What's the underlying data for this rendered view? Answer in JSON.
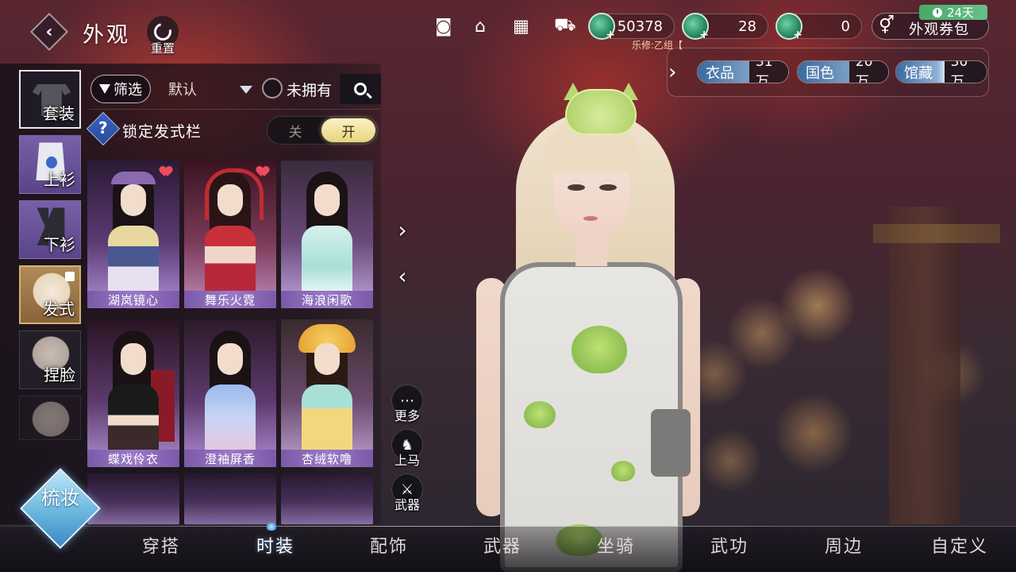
{
  "header": {
    "title": "外观",
    "reset_label": "重置"
  },
  "top_icons": [
    {
      "icon": "camera-icon",
      "caption": ""
    },
    {
      "icon": "shop-icon",
      "caption": ""
    },
    {
      "icon": "store-icon",
      "caption": ""
    },
    {
      "icon": "cart-icon",
      "caption": ""
    }
  ],
  "currencies": [
    {
      "icon": "jade-coin-icon",
      "amount": "50378"
    },
    {
      "icon": "jade-coin-icon",
      "amount": "28"
    },
    {
      "icon": "jade-coin-icon",
      "amount": "0"
    }
  ],
  "voucher": {
    "label": "外观券包",
    "days_left": "24天"
  },
  "team_label": "乐修:乙组【",
  "stats": [
    {
      "name": "衣品",
      "value": "31万"
    },
    {
      "name": "国色",
      "value": "20万"
    },
    {
      "name": "馆藏",
      "value": "30万"
    }
  ],
  "side_tabs": [
    {
      "label": "套装",
      "icon": "outfit-icon",
      "selected": true
    },
    {
      "label": "上衫",
      "icon": "top-icon",
      "selected": false
    },
    {
      "label": "下衫",
      "icon": "bottom-icon",
      "selected": false
    },
    {
      "label": "发式",
      "icon": "hairstyle-icon",
      "selected": false
    },
    {
      "label": "捏脸",
      "icon": "face-icon",
      "selected": false
    },
    {
      "label": "",
      "icon": "makeup-face-icon",
      "selected": false
    }
  ],
  "filter": {
    "filter_label": "筛选",
    "sort_value": "默认",
    "unowned_label": "未拥有"
  },
  "hair_lock": {
    "label": "锁定发式栏",
    "off_label": "关",
    "on_label": "开",
    "state": "on"
  },
  "outfits": [
    {
      "name": "湖岚镜心",
      "favorite": true
    },
    {
      "name": "舞乐火霓",
      "favorite": true
    },
    {
      "name": "海浪闲歌",
      "favorite": false
    },
    {
      "name": "蝶戏伶衣",
      "favorite": false
    },
    {
      "name": "澄袖屏香",
      "favorite": false
    },
    {
      "name": "杏绒软噜",
      "favorite": false
    }
  ],
  "side_actions": [
    {
      "label": "更多",
      "icon": "more-icon"
    },
    {
      "label": "上马",
      "icon": "horse-icon"
    },
    {
      "label": "武器",
      "icon": "weapon-icon"
    }
  ],
  "bottom_tabs": [
    {
      "label": "穿搭",
      "active": false
    },
    {
      "label": "时装",
      "active": true
    },
    {
      "label": "配饰",
      "active": false
    },
    {
      "label": "武器",
      "active": false
    },
    {
      "label": "坐骑",
      "active": false
    },
    {
      "label": "武功",
      "active": false
    },
    {
      "label": "周边",
      "active": false
    },
    {
      "label": "自定义",
      "active": false
    }
  ],
  "makeup_button": {
    "label": "梳妆"
  },
  "colors": {
    "accent_blue": "#3a6a9e",
    "card_purple": "#7a5aa8",
    "toggle_gold": "#e8d37e",
    "favorite_red": "#f04a5e",
    "voucher_green": "#4aa86a"
  }
}
